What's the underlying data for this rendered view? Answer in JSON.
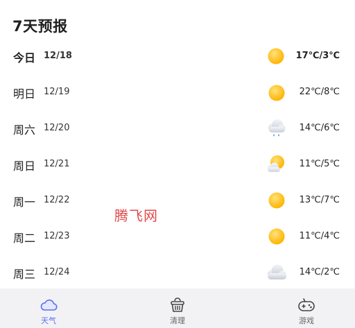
{
  "section": {
    "title": "7天预报"
  },
  "forecast": [
    {
      "day": "今日",
      "date": "12/18",
      "icon": "sunny-icon",
      "temp": "17℃/3℃",
      "today": true
    },
    {
      "day": "明日",
      "date": "12/19",
      "icon": "sunny-icon",
      "temp": "22℃/8℃"
    },
    {
      "day": "周六",
      "date": "12/20",
      "icon": "rain-cloud-icon",
      "temp": "14℃/6℃"
    },
    {
      "day": "周日",
      "date": "12/21",
      "icon": "partly-cloudy-icon",
      "temp": "11℃/5℃"
    },
    {
      "day": "周一",
      "date": "12/22",
      "icon": "sunny-icon",
      "temp": "13℃/7℃"
    },
    {
      "day": "周二",
      "date": "12/23",
      "icon": "sunny-icon",
      "temp": "11℃/4℃"
    },
    {
      "day": "周三",
      "date": "12/24",
      "icon": "cloudy-icon",
      "temp": "14℃/2℃"
    }
  ],
  "watermark": "腾飞网",
  "nav": {
    "tabs": [
      {
        "label": "天气",
        "icon": "cloud-icon",
        "active": true
      },
      {
        "label": "清理",
        "icon": "broom-basket-icon",
        "active": false
      },
      {
        "label": "游戏",
        "icon": "gamepad-icon",
        "active": false
      }
    ]
  },
  "colors": {
    "accent": "#5b6ef5",
    "sun": "#ffc21a",
    "cloud": "#d7dce3",
    "rain": "#3a8dde",
    "nav_bg": "#f2f2f4",
    "watermark": "#e04a4a"
  }
}
